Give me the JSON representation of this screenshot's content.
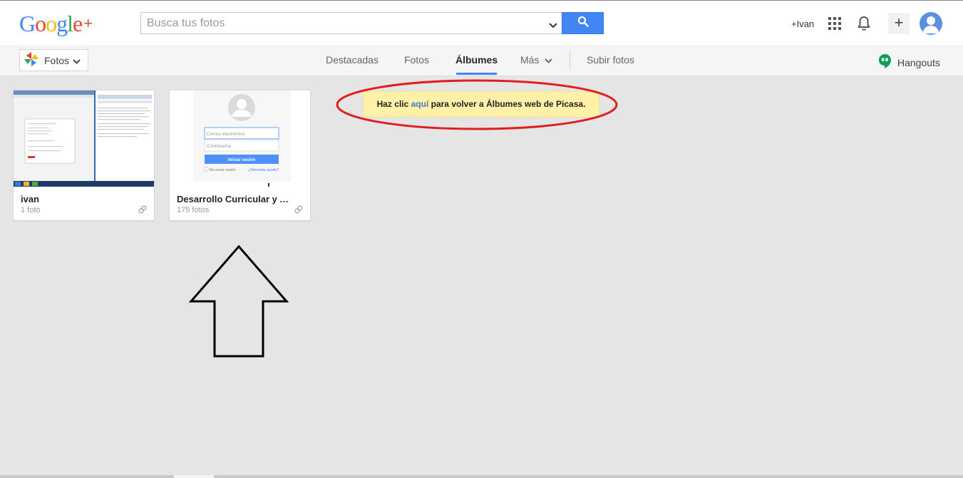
{
  "header": {
    "logo_text": "Google",
    "logo_plus": "+",
    "search": {
      "placeholder": "Busca tus fotos",
      "value": ""
    },
    "user_link": "+Ivan"
  },
  "nav": {
    "app_switcher_label": "Fotos",
    "tabs": [
      {
        "label": "Destacadas"
      },
      {
        "label": "Fotos"
      },
      {
        "label": "Álbumes",
        "active": true
      },
      {
        "label": "Más"
      },
      {
        "label": "Subir fotos"
      }
    ],
    "hangouts_label": "Hangouts"
  },
  "albums": [
    {
      "title": "ivan",
      "count": "1 foto"
    },
    {
      "title": "Desarrollo Curricular y Aul...",
      "count": "175 fotos",
      "thumb_text": {
        "email_placeholder": "Correo electrónico",
        "password_placeholder": "Contraseña",
        "signin_button": "Iniciar sesión",
        "keep_signed_in": "No cerrar sesión",
        "need_help": "¿Necesitas ayuda?"
      }
    }
  ],
  "notice": {
    "before": "Haz clic ",
    "link": "aquí",
    "after": " para volver a Álbumes web de Picasa."
  },
  "colors": {
    "accent_blue": "#4285f4",
    "notice_bg": "#fff1a8",
    "annotation_red": "#e02020",
    "annotation_black": "#000000"
  },
  "icons": [
    "search-icon",
    "dropdown-arrow-icon",
    "apps-grid-icon",
    "bell-icon",
    "share-plus-icon",
    "avatar-icon",
    "photos-pinwheel-icon",
    "chevron-down-icon",
    "hangouts-icon",
    "link-icon"
  ]
}
